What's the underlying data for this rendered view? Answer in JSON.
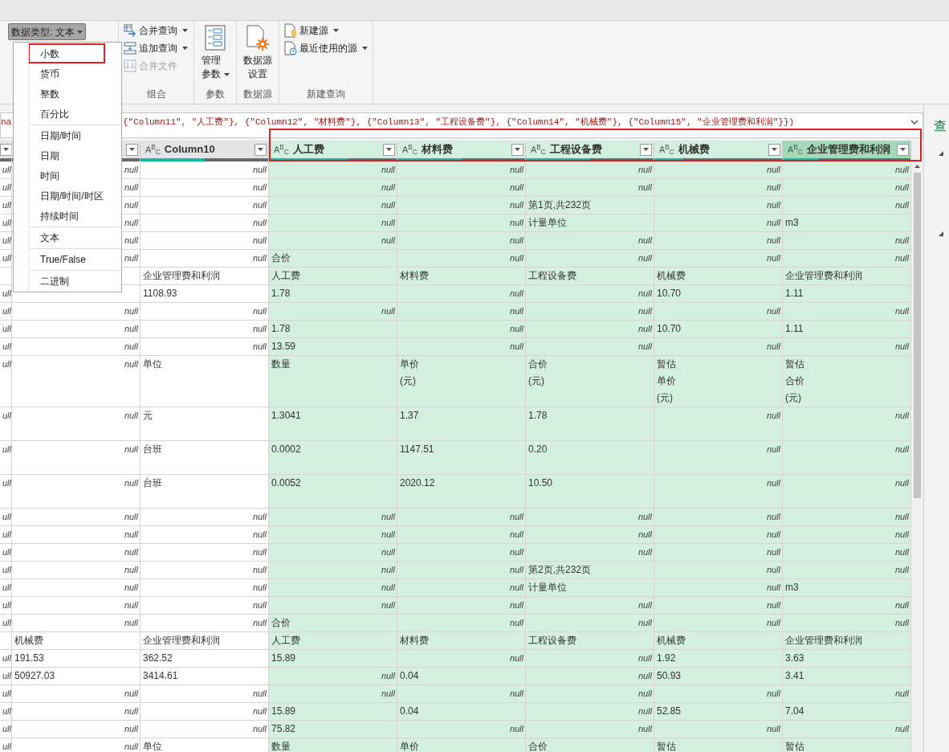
{
  "ribbon": {
    "data_type_button": {
      "label": "数据类型: 文本",
      "pressed": true
    },
    "groups": [
      {
        "label": "组合",
        "items": [
          {
            "kind": "small",
            "label": "合并查询",
            "dropdown": true,
            "disabled": false
          },
          {
            "kind": "small",
            "label": "追加查询",
            "dropdown": true,
            "disabled": false
          },
          {
            "kind": "small",
            "label": "合并文件",
            "dropdown": false,
            "disabled": true
          }
        ]
      },
      {
        "label": "参数",
        "items": [
          {
            "kind": "large",
            "label": "管理参数",
            "dropdown": true,
            "disabled": false
          }
        ]
      },
      {
        "label": "数据源",
        "items": [
          {
            "kind": "large",
            "label": "数据源设置",
            "dropdown": false,
            "disabled": false
          }
        ]
      },
      {
        "label": "新建查询",
        "items": [
          {
            "kind": "small",
            "label": "新建源",
            "dropdown": true,
            "disabled": false
          },
          {
            "kind": "small",
            "label": "最近使用的源",
            "dropdown": true,
            "disabled": false
          }
        ]
      }
    ]
  },
  "type_menu": {
    "groups": [
      [
        {
          "label": "小数",
          "highlighted": true
        },
        {
          "label": "货币",
          "highlighted": false
        },
        {
          "label": "整数",
          "highlighted": false
        },
        {
          "label": "百分比",
          "highlighted": false
        }
      ],
      [
        {
          "label": "日期/时间",
          "highlighted": false
        },
        {
          "label": "日期",
          "highlighted": false
        },
        {
          "label": "时间",
          "highlighted": false
        },
        {
          "label": "日期/时间/时区",
          "highlighted": false
        },
        {
          "label": "持续时间",
          "highlighted": false
        }
      ],
      [
        {
          "label": "文本",
          "highlighted": false
        }
      ],
      [
        {
          "label": "True/False",
          "highlighted": false
        }
      ],
      [
        {
          "label": "二进制",
          "highlighted": false
        }
      ]
    ]
  },
  "formula_bar": {
    "left_fragment": "na",
    "text": "{\"Column11\", \"人工费\"}, {\"Column12\", \"材料费\"}, {\"Column13\", \"工程设备费\"}, {\"Column14\", \"机械费\"}, {\"Column15\", \"企业管理费和利润\"}})"
  },
  "table": {
    "highlight_box": true,
    "columns": [
      {
        "selected": false,
        "active": false
      },
      {
        "selected": false,
        "active": false
      },
      {
        "type": "A$^{B}$$_{C}$",
        "name": "Column10",
        "level": 0.5,
        "selected": false,
        "active": false
      },
      {
        "type": "A$^{B}$$_{C}$",
        "name": "人工费",
        "level": 0.62,
        "selected": true,
        "active": false
      },
      {
        "type": "A$^{B}$$_{C}$",
        "name": "材料费",
        "level": 0.5,
        "selected": true,
        "active": false
      },
      {
        "type": "A$^{B}$$_{C}$",
        "name": "工程设备费",
        "level": 0.5,
        "selected": true,
        "active": false
      },
      {
        "type": "A$^{B}$$_{C}$",
        "name": "机械费",
        "level": 0.22,
        "selected": true,
        "active": false
      },
      {
        "type": "A$^{B}$$_{C}$",
        "name": "企业管理费和利润",
        "level": 0.28,
        "selected": true,
        "active": true
      }
    ],
    "rows": [
      {
        "cells": [
          {
            "null": "ull"
          },
          {
            "null": "null"
          },
          {
            "null": "null"
          },
          {
            "null": "null"
          },
          {
            "null": "null"
          },
          {
            "null": "null"
          },
          {
            "null": "null"
          },
          {
            "null": "null"
          }
        ]
      },
      {
        "cells": [
          {
            "null": "ull"
          },
          {
            "null": "null"
          },
          {
            "null": "null"
          },
          {
            "null": "null"
          },
          {
            "null": "null"
          },
          {
            "null": "null"
          },
          {
            "null": "null"
          },
          {
            "null": "null"
          }
        ]
      },
      {
        "cells": [
          {
            "null": "ull"
          },
          {
            "null": "null"
          },
          {
            "null": "null"
          },
          {
            "null": "null"
          },
          {
            "null": "null"
          },
          "第1页,共232页",
          {
            "null": "null"
          },
          {
            "null": "null"
          }
        ]
      },
      {
        "cells": [
          {
            "null": "ull"
          },
          {
            "null": "null"
          },
          {
            "null": "null"
          },
          {
            "null": "null"
          },
          {
            "null": "null"
          },
          "计量单位",
          {
            "null": "null"
          },
          "m3"
        ]
      },
      {
        "cells": [
          {
            "null": "ull"
          },
          {
            "null": "null"
          },
          {
            "null": "null"
          },
          {
            "null": "null"
          },
          {
            "null": "null"
          },
          {
            "null": "null"
          },
          {
            "null": "null"
          },
          {
            "null": "null"
          }
        ]
      },
      {
        "cells": [
          {
            "null": "ull"
          },
          {
            "null": "null"
          },
          {
            "null": "null"
          },
          "合价",
          {
            "null": "null"
          },
          {
            "null": "null"
          },
          {
            "null": "null"
          },
          {
            "null": "null"
          }
        ]
      },
      {
        "cells": [
          null,
          null,
          "企业管理费和利润",
          "人工费",
          "材料费",
          "工程设备费",
          "机械费",
          "企业管理费和利润"
        ]
      },
      {
        "cells": [
          {
            "null": "ull"
          },
          null,
          "1108.93",
          "1.78",
          {
            "null": "null"
          },
          {
            "null": "null"
          },
          "10.70",
          "1.11"
        ]
      },
      {
        "cells": [
          {
            "null": "ull"
          },
          {
            "null": "null"
          },
          {
            "null": "null"
          },
          {
            "null": "null"
          },
          {
            "null": "null"
          },
          {
            "null": "null"
          },
          {
            "null": "null"
          },
          {
            "null": "null"
          }
        ]
      },
      {
        "cells": [
          {
            "null": "ull"
          },
          {
            "null": "null"
          },
          {
            "null": "null"
          },
          "1.78",
          {
            "null": "null"
          },
          {
            "null": "null"
          },
          "10.70",
          "1.11"
        ]
      },
      {
        "cells": [
          {
            "null": "ull"
          },
          {
            "null": "null"
          },
          {
            "null": "null"
          },
          "13.59",
          {
            "null": "null"
          },
          {
            "null": "null"
          },
          {
            "null": "null"
          },
          {
            "null": "null"
          }
        ]
      },
      {
        "kind": "stacked",
        "cells": [
          {
            "null": "ull"
          },
          {
            "null": "null"
          },
          "单位",
          "数量",
          "单价(元)",
          "合价(元)",
          "暂估单价(元)",
          "暂估合价(元)"
        ]
      },
      {
        "kind": "double",
        "cells": [
          {
            "null": "ull"
          },
          {
            "null": "null"
          },
          "元",
          "1.3041",
          "1.37",
          "1.78",
          {
            "null": "null"
          },
          {
            "null": "null"
          }
        ]
      },
      {
        "kind": "double",
        "cells": [
          {
            "null": "ull"
          },
          {
            "null": "null"
          },
          "台班",
          "0.0002",
          "1147.51",
          "0.20",
          {
            "null": "null"
          },
          {
            "null": "null"
          }
        ]
      },
      {
        "kind": "double",
        "cells": [
          {
            "null": "ull"
          },
          {
            "null": "null"
          },
          "台班",
          "0.0052",
          "2020.12",
          "10.50",
          {
            "null": "null"
          },
          {
            "null": "null"
          }
        ]
      },
      {
        "cells": [
          {
            "null": "ull"
          },
          {
            "null": "null"
          },
          {
            "null": "null"
          },
          {
            "null": "null"
          },
          {
            "null": "null"
          },
          {
            "null": "null"
          },
          {
            "null": "null"
          },
          {
            "null": "null"
          }
        ]
      },
      {
        "cells": [
          {
            "null": "ull"
          },
          {
            "null": "null"
          },
          {
            "null": "null"
          },
          {
            "null": "null"
          },
          {
            "null": "null"
          },
          {
            "null": "null"
          },
          {
            "null": "null"
          },
          {
            "null": "null"
          }
        ]
      },
      {
        "cells": [
          {
            "null": "ull"
          },
          {
            "null": "null"
          },
          {
            "null": "null"
          },
          {
            "null": "null"
          },
          {
            "null": "null"
          },
          {
            "null": "null"
          },
          {
            "null": "null"
          },
          {
            "null": "null"
          }
        ]
      },
      {
        "cells": [
          {
            "null": "ull"
          },
          {
            "null": "null"
          },
          {
            "null": "null"
          },
          {
            "null": "null"
          },
          {
            "null": "null"
          },
          "第2页,共232页",
          {
            "null": "null"
          },
          {
            "null": "null"
          }
        ]
      },
      {
        "cells": [
          {
            "null": "ull"
          },
          {
            "null": "null"
          },
          {
            "null": "null"
          },
          {
            "null": "null"
          },
          {
            "null": "null"
          },
          "计量单位",
          {
            "null": "null"
          },
          "m3"
        ]
      },
      {
        "cells": [
          {
            "null": "ull"
          },
          {
            "null": "null"
          },
          {
            "null": "null"
          },
          {
            "null": "null"
          },
          {
            "null": "null"
          },
          {
            "null": "null"
          },
          {
            "null": "null"
          },
          {
            "null": "null"
          }
        ]
      },
      {
        "cells": [
          {
            "null": "ull"
          },
          {
            "null": "null"
          },
          {
            "null": "null"
          },
          "合价",
          {
            "null": "null"
          },
          {
            "null": "null"
          },
          {
            "null": "null"
          },
          {
            "null": "null"
          }
        ]
      },
      {
        "cells": [
          null,
          "机械费",
          "企业管理费和利润",
          "人工费",
          "材料费",
          "工程设备费",
          "机械费",
          "企业管理费和利润"
        ]
      },
      {
        "cells": [
          {
            "null": "ull"
          },
          "191.53",
          "362.52",
          "15.89",
          {
            "null": "null"
          },
          {
            "null": "null"
          },
          "1.92",
          "3.63"
        ]
      },
      {
        "cells": [
          {
            "null": "ull"
          },
          "50927.03",
          "3414.61",
          {
            "null": "null"
          },
          "0.04",
          {
            "null": "null"
          },
          "50.93",
          "3.41"
        ]
      },
      {
        "cells": [
          {
            "null": "ull"
          },
          {
            "null": "null"
          },
          {
            "null": "null"
          },
          {
            "null": "null"
          },
          {
            "null": "null"
          },
          {
            "null": "null"
          },
          {
            "null": "null"
          },
          {
            "null": "null"
          }
        ]
      },
      {
        "cells": [
          {
            "null": "ull"
          },
          {
            "null": "null"
          },
          {
            "null": "null"
          },
          "15.89",
          "0.04",
          {
            "null": "null"
          },
          "52.85",
          "7.04"
        ]
      },
      {
        "cells": [
          {
            "null": "ull"
          },
          {
            "null": "null"
          },
          {
            "null": "null"
          },
          "75.82",
          {
            "null": "null"
          },
          {
            "null": "null"
          },
          {
            "null": "null"
          },
          {
            "null": "null"
          }
        ]
      },
      {
        "cells": [
          {
            "null": "ull"
          },
          {
            "null": "null"
          },
          "单位",
          "数量",
          "单价",
          "合价",
          "暂估",
          "暂估"
        ]
      }
    ]
  },
  "right_pane": {
    "title": "查"
  }
}
